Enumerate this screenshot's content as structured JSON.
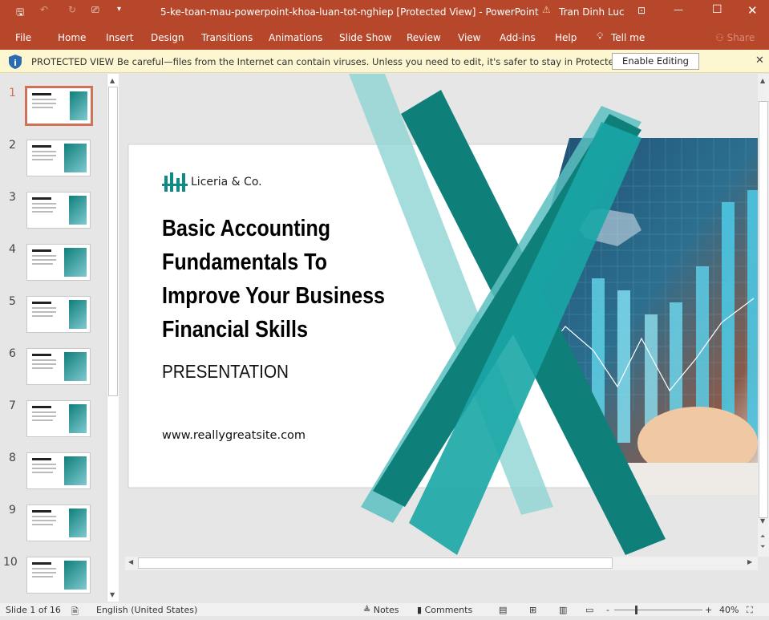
{
  "titlebar": {
    "doc_title": "5-ke-toan-mau-powerpoint-khoa-luan-tot-nghiep [Protected View]  -  PowerPoint",
    "user": "Tran Dinh Luc"
  },
  "menu": {
    "items": [
      "File",
      "Home",
      "Insert",
      "Design",
      "Transitions",
      "Animations",
      "Slide Show",
      "Review",
      "View",
      "Add-ins",
      "Help"
    ],
    "tell_me": "Tell me",
    "share": "Share"
  },
  "protected": {
    "label": "PROTECTED VIEW",
    "message": "Be careful—files from the Internet can contain viruses. Unless you need to edit, it's safer to stay in Protected View.",
    "button": "Enable Editing"
  },
  "thumbnails": [
    "1",
    "2",
    "3",
    "4",
    "5",
    "6",
    "7",
    "8",
    "9",
    "10"
  ],
  "slide": {
    "brand": "Liceria & Co.",
    "title_lines": [
      "Basic Accounting",
      "Fundamentals To",
      "Improve Your Business",
      "Financial Skills"
    ],
    "subtitle": "PRESENTATION",
    "website": "www.reallygreatsite.com"
  },
  "status": {
    "slide": "Slide 1 of 16",
    "language": "English (United States)",
    "notes": "Notes",
    "comments": "Comments",
    "zoom": "40%"
  },
  "colors": {
    "ribbon": "#b7472a",
    "teal": "#0f7f7a",
    "light_teal": "#8fd3d3",
    "selected_thumb": "#d0725a"
  }
}
